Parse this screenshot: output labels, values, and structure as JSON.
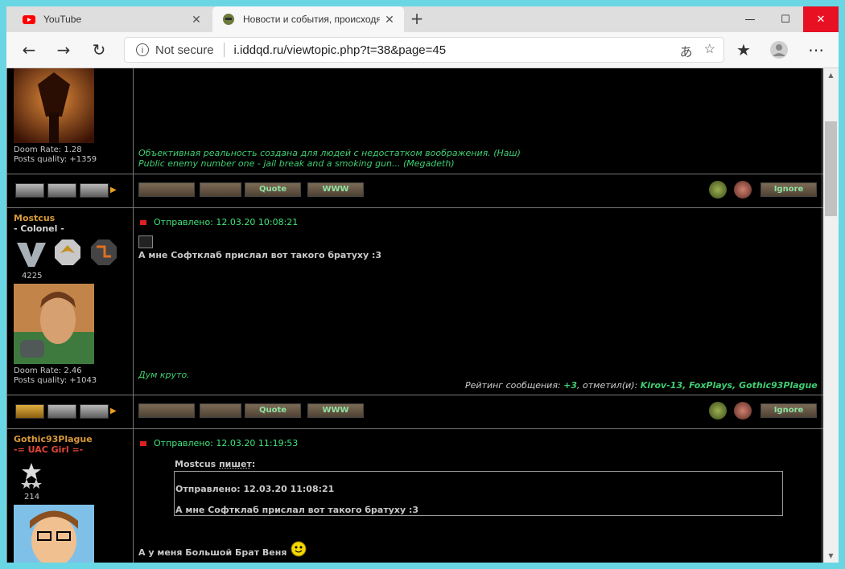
{
  "browser": {
    "tabs": [
      {
        "title": "YouTube",
        "active": false
      },
      {
        "title": "Новости и события, происходя",
        "active": true
      }
    ],
    "address": {
      "security": "Not secure",
      "url": "i.iddqd.ru/viewtopic.php?t=38&page=45"
    },
    "colors": {
      "close_button": "#e81123",
      "page_bg": "#000000",
      "username": "#d69a3a",
      "green_text": "#3fce72"
    }
  },
  "posts": [
    {
      "doom_rate": "Doom Rate: 1.28",
      "posts_quality": "Posts quality: +1359",
      "signature": [
        "Объективная реальность создана для людей с недостатком воображения. (Наш)",
        "Public enemy number one - jail break and a smoking gun... (Megadeth)"
      ]
    },
    {
      "username": "Mostcus",
      "rank": "- Colonel -",
      "post_count": "4225",
      "posted": "Отправлено: 12.03.20 10:08:21",
      "message": "А мне Софтклаб прислал вот такого братуху :3",
      "signature": [
        "Дум круто."
      ],
      "doom_rate": "Doom Rate: 2.46",
      "posts_quality": "Posts quality: +1043",
      "rating_prefix": "Рейтинг сообщения:",
      "rating_value": "+3",
      "rating_mid": ", отметил(и):",
      "rating_users": "Kirov-13, FoxPlays, Gothic93Plague"
    },
    {
      "username": "Gothic93Plague",
      "rank": "-= UAC Girl =-",
      "post_count": "214",
      "posted": "Отправлено: 12.03.20 11:19:53",
      "quote_author": "Mostcus",
      "quote_word": "пишет",
      "quote_posted": "Отправлено: 12.03.20 11:08:21",
      "quote_text": "А мне Софтклаб прислал вот такого братуху :3",
      "message": "А у меня Большой Брат Веня"
    }
  ],
  "buttons": {
    "quote": "Quote",
    "www": "WWW",
    "ignore": "Ignore"
  }
}
